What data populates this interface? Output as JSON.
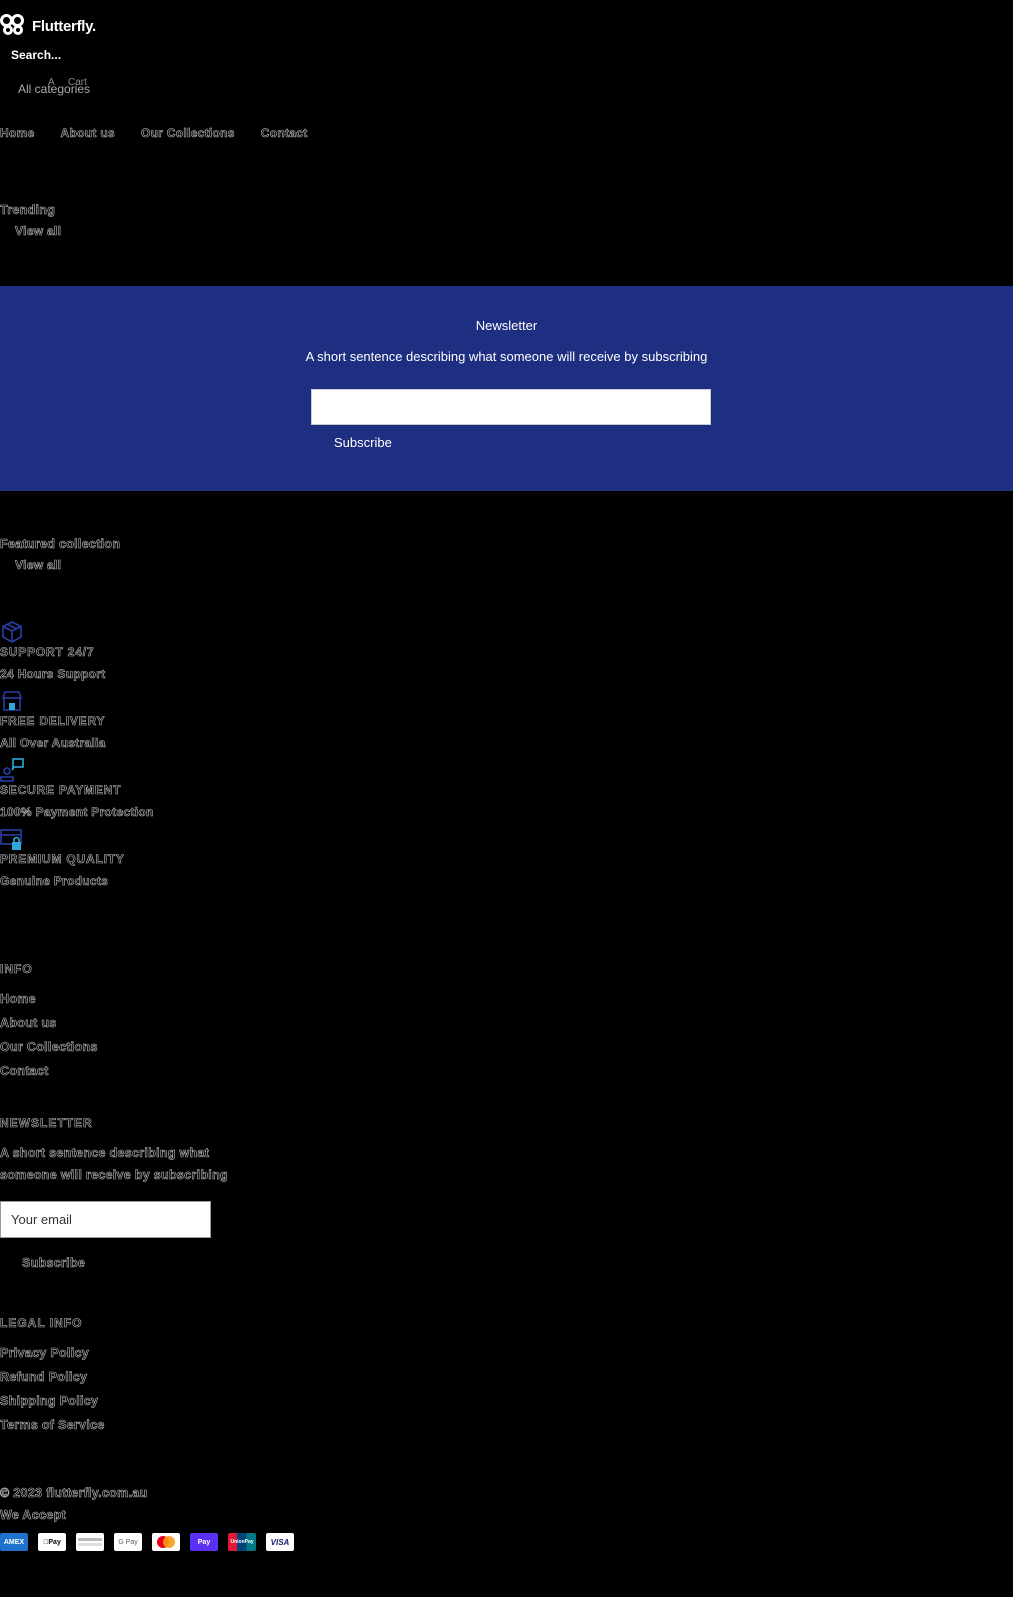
{
  "header": {
    "logo_text": "Flutterfly.",
    "search_placeholder": "Search...",
    "category_select": "All categories",
    "account_label": "A",
    "cart_label": "Cart"
  },
  "nav": [
    "Home",
    "About us",
    "Our Collections",
    "Contact"
  ],
  "trending": {
    "title": "Trending",
    "view_all": "View all"
  },
  "newsletter": {
    "title": "Newsletter",
    "subtitle": "A short sentence describing what someone will receive by subscribing",
    "button": "Subscribe",
    "bg_color": "#1e2e80"
  },
  "featured": {
    "title": "Featured collection",
    "view_all": "View all"
  },
  "features": [
    {
      "icon": "box-icon",
      "title": "SUPPORT 24/7",
      "subtitle": "24 Hours Support"
    },
    {
      "icon": "store-icon",
      "title": "FREE DELIVERY",
      "subtitle": "All Over Australia"
    },
    {
      "icon": "support-chat-icon",
      "title": "SECURE PAYMENT",
      "subtitle": "100% Payment Protection"
    },
    {
      "icon": "secure-card-icon",
      "title": "PREMIUM QUALITY",
      "subtitle": "Genuine Products"
    }
  ],
  "footer": {
    "info_heading": "INFO",
    "info_links": [
      "Home",
      "About us",
      "Our Collections",
      "Contact"
    ],
    "newsletter_heading": "NEWSLETTER",
    "newsletter_line1": "A short sentence describing what",
    "newsletter_line2": "someone will receive by subscribing",
    "email_placeholder": "Your email",
    "subscribe": "Subscribe",
    "legal_heading": "LEGAL INFO",
    "legal_links": [
      "Privacy Policy",
      "Refund Policy",
      "Shipping Policy",
      "Terms of Service"
    ],
    "copyright": "© 2023 flutterfly.com.au",
    "we_accept": "We Accept"
  },
  "payments": [
    {
      "name": "amex-icon",
      "label": "AMEX",
      "bg": "#1f72cd",
      "fg": "#ffffff"
    },
    {
      "name": "apple-pay-icon",
      "label": "Pay",
      "bg": "#ffffff",
      "fg": "#000000"
    },
    {
      "name": "diners-club-icon",
      "label": "",
      "bg": "#ffffff",
      "fg": "#555555"
    },
    {
      "name": "google-pay-icon",
      "label": "G Pay",
      "bg": "#ffffff",
      "fg": "#5f6368"
    },
    {
      "name": "mastercard-icon",
      "label": "",
      "bg": "#ffffff",
      "fg": "#000000"
    },
    {
      "name": "shop-pay-icon",
      "label": "Pay",
      "bg": "#5a31f4",
      "fg": "#ffffff"
    },
    {
      "name": "unionpay-icon",
      "label": "UnionPay",
      "bg": "#e21836",
      "fg": "#ffffff"
    },
    {
      "name": "visa-icon",
      "label": "VISA",
      "bg": "#ffffff",
      "fg": "#1a1f71"
    }
  ]
}
